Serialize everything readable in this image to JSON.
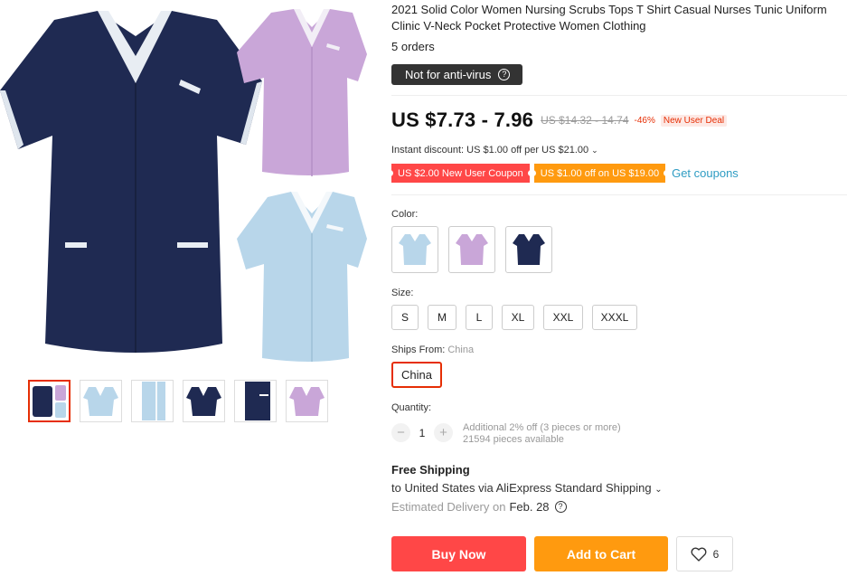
{
  "product": {
    "title": "2021 Solid Color Women Nursing Scrubs Tops T Shirt Casual Nurses Tunic Uniform Clinic V-Neck Pocket Protective Women Clothing",
    "orders": "5 orders",
    "antivirus_label": "Not for anti-virus",
    "antivirus_icon": "question-icon"
  },
  "price": {
    "current": "US $7.73 - 7.96",
    "original": "US $14.32 - 14.74",
    "discount": "-46%",
    "deal": "New User Deal"
  },
  "promo": {
    "instant": "Instant discount: US $1.00 off per US $21.00",
    "coupon_red": "US $2.00 New User Coupon",
    "coupon_orange": "US $1.00 off on US $19.00",
    "get_coupons": "Get coupons"
  },
  "color": {
    "label": "Color:",
    "options": [
      "light-blue",
      "lavender",
      "navy"
    ]
  },
  "size": {
    "label": "Size:",
    "options": [
      "S",
      "M",
      "L",
      "XL",
      "XXL",
      "XXXL"
    ]
  },
  "ships": {
    "label": "Ships From:",
    "selected_inline": "China",
    "option": "China"
  },
  "quantity": {
    "label": "Quantity:",
    "minus": "−",
    "value": "1",
    "plus": "+",
    "note1": "Additional 2% off (3 pieces or more)",
    "note2": "21594 pieces available"
  },
  "shipping": {
    "free": "Free Shipping",
    "to": "to United States via AliExpress Standard Shipping",
    "est_prefix": "Estimated Delivery on",
    "est_date": "Feb. 28"
  },
  "actions": {
    "buy": "Buy Now",
    "cart": "Add to Cart",
    "wishlist_count": "6"
  },
  "colors": {
    "navy": "#1f2a52",
    "lavender": "#c9a6d8",
    "lightblue": "#b8d6ea",
    "red": "#ff4747",
    "orange": "#ff9a0f",
    "link": "#2e9cc3"
  }
}
